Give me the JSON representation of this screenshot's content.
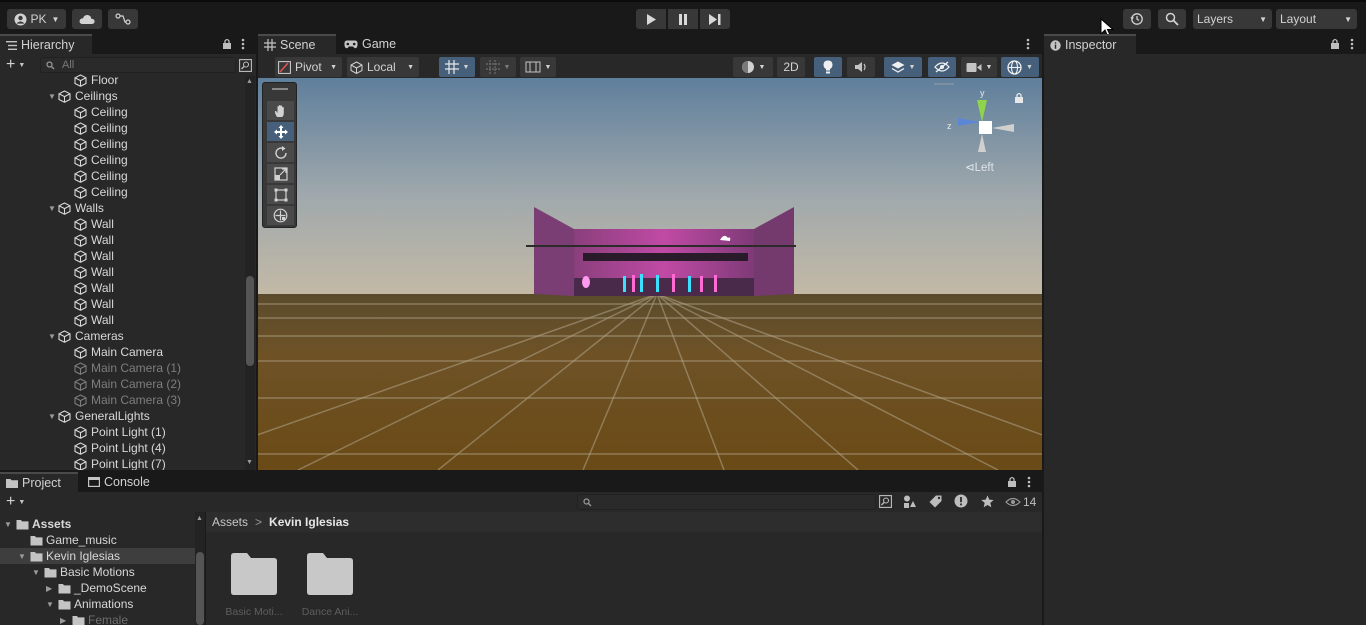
{
  "toolbar": {
    "account_label": "PK",
    "layers_label": "Layers",
    "layout_label": "Layout"
  },
  "hierarchy": {
    "tab_label": "Hierarchy",
    "search_placeholder": "All",
    "rows": [
      {
        "label": "Floor",
        "depth": 2,
        "expander": false,
        "dim": false
      },
      {
        "label": "Ceilings",
        "depth": 1,
        "expander": true,
        "dim": false
      },
      {
        "label": "Ceiling",
        "depth": 2,
        "expander": false,
        "dim": false
      },
      {
        "label": "Ceiling",
        "depth": 2,
        "expander": false,
        "dim": false
      },
      {
        "label": "Ceiling",
        "depth": 2,
        "expander": false,
        "dim": false
      },
      {
        "label": "Ceiling",
        "depth": 2,
        "expander": false,
        "dim": false
      },
      {
        "label": "Ceiling",
        "depth": 2,
        "expander": false,
        "dim": false
      },
      {
        "label": "Ceiling",
        "depth": 2,
        "expander": false,
        "dim": false
      },
      {
        "label": "Walls",
        "depth": 1,
        "expander": true,
        "dim": false
      },
      {
        "label": "Wall",
        "depth": 2,
        "expander": false,
        "dim": false
      },
      {
        "label": "Wall",
        "depth": 2,
        "expander": false,
        "dim": false
      },
      {
        "label": "Wall",
        "depth": 2,
        "expander": false,
        "dim": false
      },
      {
        "label": "Wall",
        "depth": 2,
        "expander": false,
        "dim": false
      },
      {
        "label": "Wall",
        "depth": 2,
        "expander": false,
        "dim": false
      },
      {
        "label": "Wall",
        "depth": 2,
        "expander": false,
        "dim": false
      },
      {
        "label": "Wall",
        "depth": 2,
        "expander": false,
        "dim": false
      },
      {
        "label": "Cameras",
        "depth": 1,
        "expander": true,
        "dim": false
      },
      {
        "label": "Main Camera",
        "depth": 2,
        "expander": false,
        "dim": false
      },
      {
        "label": "Main Camera (1)",
        "depth": 2,
        "expander": false,
        "dim": true
      },
      {
        "label": "Main Camera (2)",
        "depth": 2,
        "expander": false,
        "dim": true
      },
      {
        "label": "Main Camera (3)",
        "depth": 2,
        "expander": false,
        "dim": true
      },
      {
        "label": "GeneralLights",
        "depth": 1,
        "expander": true,
        "dim": false
      },
      {
        "label": "Point Light (1)",
        "depth": 2,
        "expander": false,
        "dim": false
      },
      {
        "label": "Point Light (4)",
        "depth": 2,
        "expander": false,
        "dim": false
      },
      {
        "label": "Point Light (7)",
        "depth": 2,
        "expander": false,
        "dim": false
      }
    ]
  },
  "scene": {
    "tab_scene": "Scene",
    "tab_game": "Game",
    "pivot_label": "Pivot",
    "local_label": "Local",
    "twod_label": "2D",
    "gizmo_axis_y": "y",
    "gizmo_axis_z": "z",
    "gizmo_view_label": "⊲Left"
  },
  "inspector": {
    "tab_label": "Inspector"
  },
  "project": {
    "tab_project": "Project",
    "tab_console": "Console",
    "hidden_count": "14",
    "breadcrumb_root": "Assets",
    "breadcrumb_sep": ">",
    "breadcrumb_current": "Kevin Iglesias",
    "tree": [
      {
        "label": "Assets",
        "depth": 0,
        "expander": true,
        "bold": true,
        "selected": false
      },
      {
        "label": "Game_music",
        "depth": 1,
        "expander": false,
        "bold": false,
        "selected": false
      },
      {
        "label": "Kevin Iglesias",
        "depth": 1,
        "expander": true,
        "bold": false,
        "selected": true
      },
      {
        "label": "Basic Motions",
        "depth": 2,
        "expander": true,
        "bold": false,
        "selected": false
      },
      {
        "label": "_DemoScene",
        "depth": 3,
        "expander": "collapsed",
        "bold": false,
        "selected": false
      },
      {
        "label": "Animations",
        "depth": 3,
        "expander": true,
        "bold": false,
        "selected": false
      },
      {
        "label": "Female",
        "depth": 4,
        "expander": "collapsed",
        "bold": false,
        "selected": false
      }
    ],
    "folders": [
      {
        "label": "Basic Moti..."
      },
      {
        "label": "Dance Ani..."
      }
    ]
  }
}
